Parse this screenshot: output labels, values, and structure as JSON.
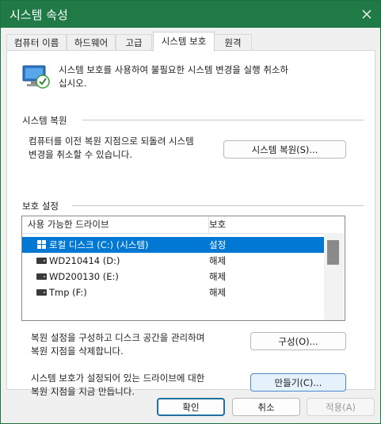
{
  "window": {
    "title": "시스템 속성"
  },
  "tabs": [
    {
      "label": "컴퓨터 이름"
    },
    {
      "label": "하드웨어"
    },
    {
      "label": "고급"
    },
    {
      "label": "시스템 보호"
    },
    {
      "label": "원격"
    }
  ],
  "active_tab": "시스템 보호",
  "intro": {
    "line1": "시스템 보호를 사용하여 불필요한 시스템 변경을 실행 취소하",
    "line2": "십시오."
  },
  "restore": {
    "title": "시스템 복원",
    "desc_line1": "컴퓨터를 이전 복원 지점으로 되돌려 시스템",
    "desc_line2": "변경을 취소할 수 있습니다.",
    "button": "시스템 복원(S)..."
  },
  "protection": {
    "title": "보호 설정",
    "columns": {
      "drive": "사용 가능한 드라이브",
      "protection": "보호"
    },
    "drives": [
      {
        "name": "로컬 디스크 (C:) (시스템)",
        "protection": "설정",
        "selected": true,
        "icon": "system-drive-icon"
      },
      {
        "name": "WD210414 (D:)",
        "protection": "해제",
        "selected": false,
        "icon": "drive-icon"
      },
      {
        "name": "WD200130 (E:)",
        "protection": "해제",
        "selected": false,
        "icon": "drive-icon"
      },
      {
        "name": "Tmp (F:)",
        "protection": "해제",
        "selected": false,
        "icon": "drive-icon"
      }
    ]
  },
  "configure": {
    "desc_line1": "복원 설정을 구성하고 디스크 공간을 관리하며",
    "desc_line2": "복원 지점을 삭제합니다.",
    "button": "구성(O)..."
  },
  "create": {
    "desc_line1": "시스템 보호가 설정되어 있는 드라이브에 대한",
    "desc_line2": "복원 지점을 지금 만듭니다.",
    "button": "만들기(C)..."
  },
  "footer": {
    "ok": "확인",
    "cancel": "취소",
    "apply": "적용(A)"
  },
  "colors": {
    "titlebar": "#1f7a45",
    "selection": "#0078d4"
  }
}
